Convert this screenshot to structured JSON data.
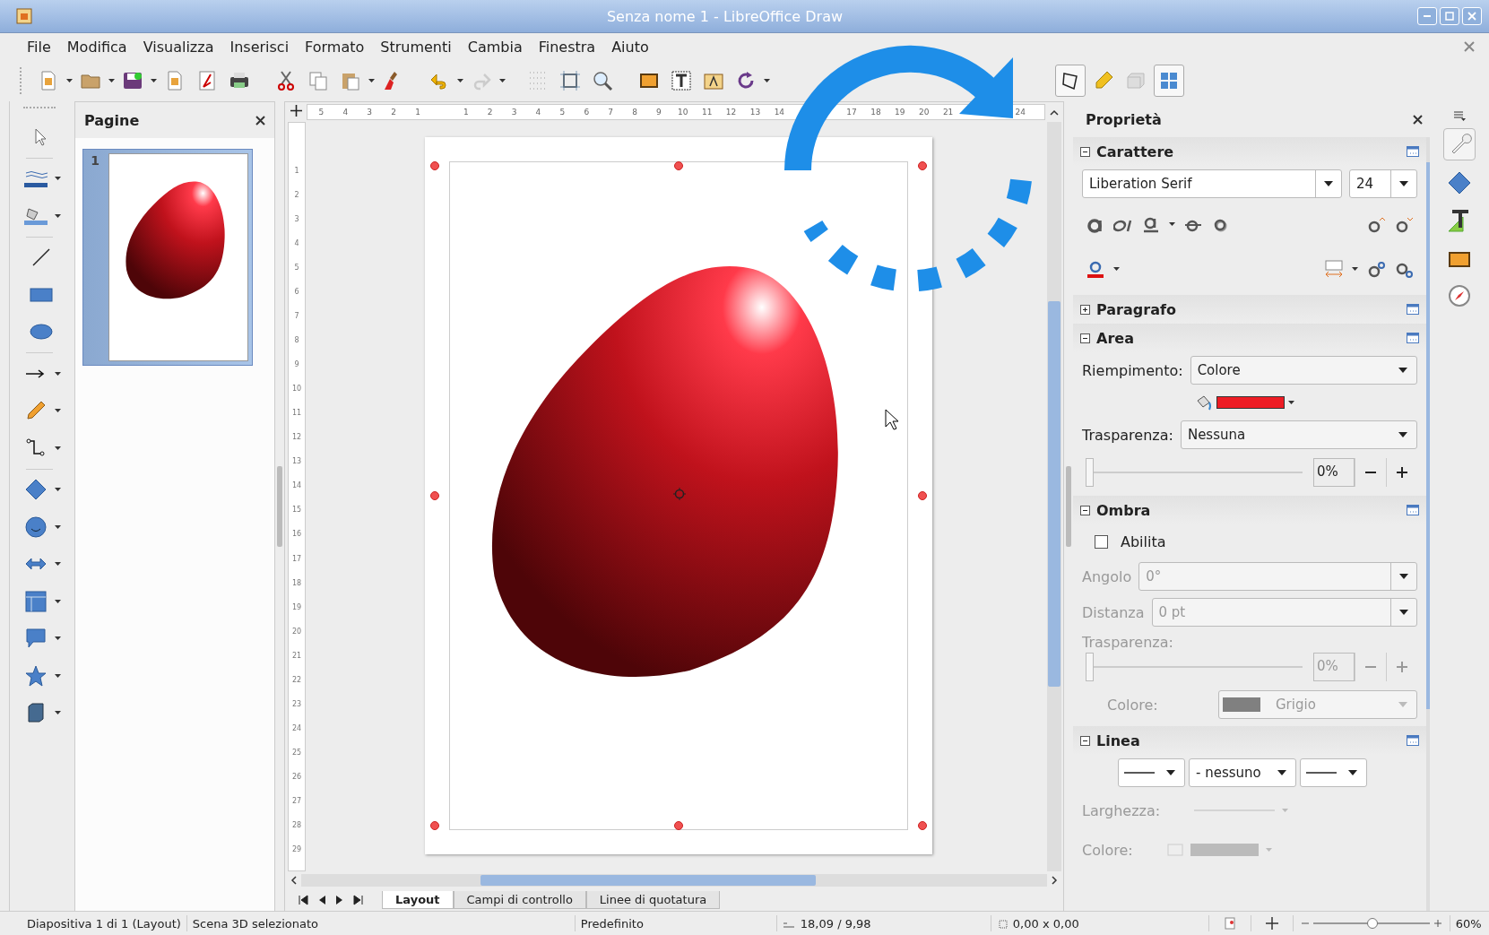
{
  "window": {
    "title": "Senza nome 1 - LibreOffice Draw"
  },
  "menu": [
    "File",
    "Modifica",
    "Visualizza",
    "Inserisci",
    "Formato",
    "Strumenti",
    "Cambia",
    "Finestra",
    "Aiuto"
  ],
  "pages_panel": {
    "title": "Pagine",
    "pages": [
      {
        "number": "1",
        "selected": true
      }
    ]
  },
  "ruler": {
    "horizontal": [
      [
        "5",
        "4",
        "3",
        "2",
        "1"
      ],
      [
        "1",
        "2",
        "3",
        "4",
        "5",
        "6",
        "7",
        "8",
        "9",
        "10",
        "11",
        "12",
        "13",
        "14"
      ],
      [
        "17",
        "18",
        "19",
        "20",
        "21"
      ],
      [
        "24"
      ]
    ],
    "vertical": [
      "1",
      "2",
      "3",
      "4",
      "5",
      "6",
      "7",
      "8",
      "9",
      "10",
      "11",
      "12",
      "13",
      "14",
      "15",
      "16",
      "17",
      "18",
      "19",
      "20",
      "21",
      "22",
      "23",
      "24",
      "25",
      "26",
      "27",
      "28",
      "29"
    ]
  },
  "layer_tabs": [
    {
      "label": "Layout",
      "selected": true
    },
    {
      "label": "Campi di controllo",
      "selected": false
    },
    {
      "label": "Linee di quotatura",
      "selected": false
    }
  ],
  "sidebar": {
    "title": "Proprietà",
    "character": {
      "title": "Carattere",
      "expanded": true,
      "font": "Liberation Serif",
      "size": "24"
    },
    "paragraph": {
      "title": "Paragrafo",
      "expanded": false
    },
    "area": {
      "title": "Area",
      "expanded": true,
      "fill_label": "Riempimento:",
      "fill": "Colore",
      "color": "#ed1c24",
      "transparency_label": "Trasparenza:",
      "transparency": "Nessuna",
      "level": 0,
      "percent": "0%"
    },
    "shadow": {
      "title": "Ombra",
      "expanded": true,
      "enable_label": "Abilita",
      "checked": false,
      "disabled": true,
      "angle_label": "Angolo",
      "angle": "0°",
      "distance_label": "Distanza",
      "distance": "0 pt",
      "transparency_label": "Trasparenza:",
      "level": 0,
      "percent": "0%",
      "color_label": "Colore:",
      "color_name": "Grigio"
    },
    "line": {
      "title": "Linea",
      "expanded": true,
      "style": "- nessuno",
      "width_label": "Larghezza:",
      "color_label": "Colore:"
    }
  },
  "status_bar": {
    "slide": "Diapositiva 1 di 1 (Layout)",
    "selection": "Scena 3D selezionato",
    "master": "Predefinito",
    "position": "18,09 / 9,98",
    "size": "0,00 x 0,00",
    "zoom_slider": {
      "level": 0.5
    },
    "zoom": "60%"
  }
}
